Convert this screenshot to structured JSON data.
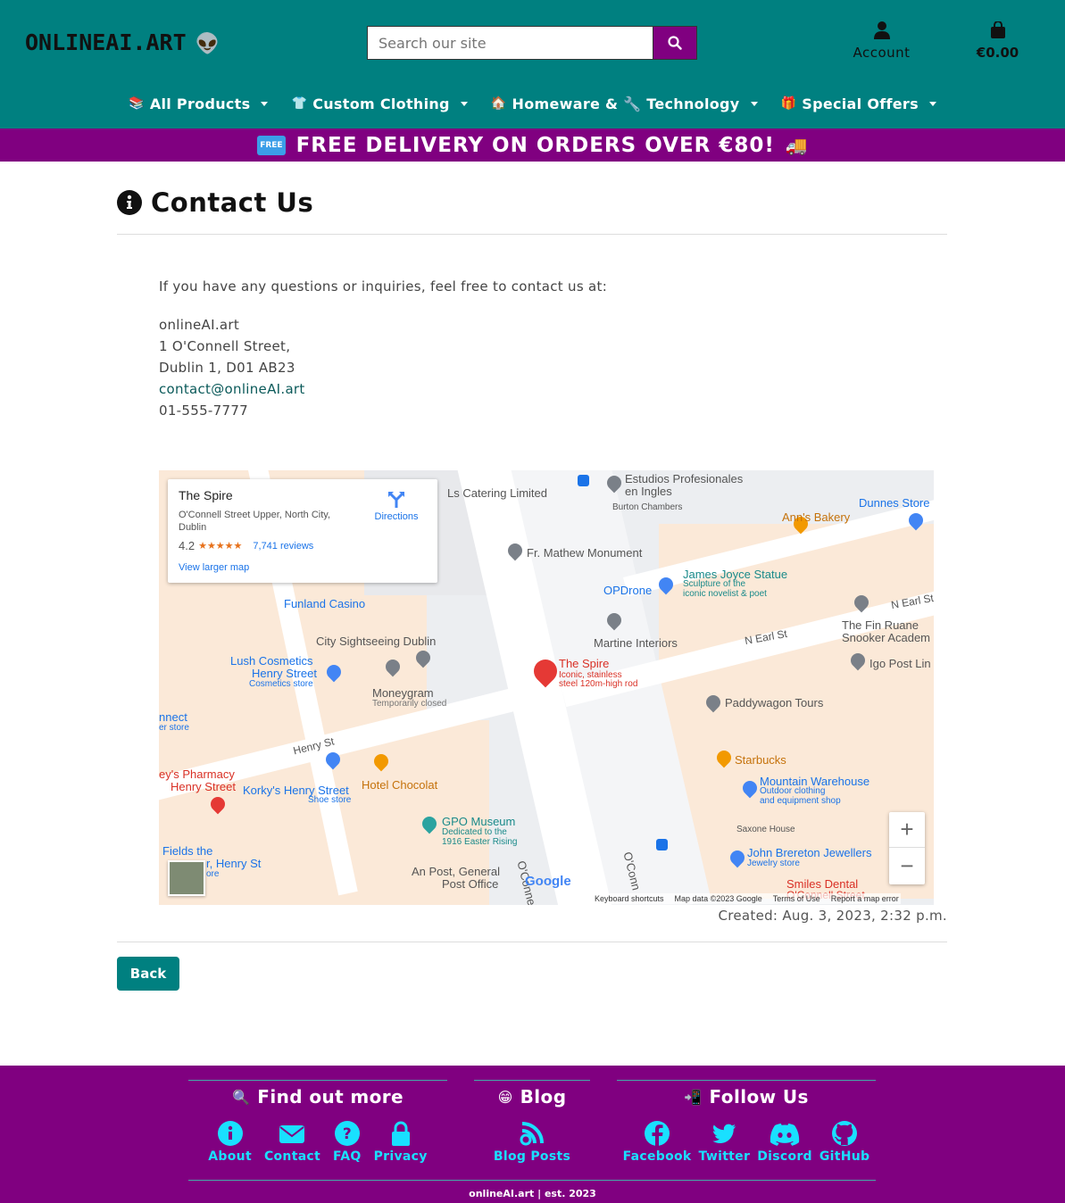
{
  "header": {
    "logo": "ONLINEAI.ART",
    "search_placeholder": "Search our site",
    "account_label": "Account",
    "cart_total": "€0.00"
  },
  "nav": [
    {
      "emoji": "📚",
      "label": "All Products"
    },
    {
      "emoji": "👕",
      "label": "Custom Clothing"
    },
    {
      "emoji": "🏠",
      "label": "Homeware & 🔧 Technology"
    },
    {
      "emoji": "🎁",
      "label": "Special Offers"
    }
  ],
  "promo": {
    "badge": "FREE",
    "text": "FREE DELIVERY ON ORDERS OVER €80!",
    "truck": "🚚"
  },
  "main": {
    "title": "Contact Us",
    "intro": "If you have any questions or inquiries, feel free to contact us at:",
    "address_lines": [
      "onlineAI.art",
      "1 O'Connell Street,",
      "Dublin 1, D01 AB23"
    ],
    "email": "contact@onlineAI.art",
    "phone": "01-555-7777",
    "created": "Created: Aug. 3, 2023, 2:32 p.m.",
    "back_label": "Back"
  },
  "map": {
    "place_title": "The Spire",
    "place_address": "O'Connell Street Upper, North City, Dublin",
    "rating": "4.2",
    "stars": "★★★★★",
    "reviews": "7,741 reviews",
    "larger_map": "View larger map",
    "directions": "Directions",
    "labels": {
      "ls_catering": "Ls Catering Limited",
      "estudios": "Estudios Profesionales",
      "estudios2": "en Ingles",
      "burton": "Burton Chambers",
      "dunnes": "Dunnes Store",
      "anns": "Ann's Bakery",
      "mathew": "Fr. Mathew Monument",
      "joyce": "James Joyce Statue",
      "joyce_sub1": "Sculpture of the",
      "joyce_sub2": "iconic novelist & poet",
      "opdrone": "OPDrone",
      "funland": "Funland Casino",
      "earl_st": "N Earl St",
      "earl_st2": "N Earl St",
      "fin_ruane": "The Fin Ruane",
      "fin_ruane2": "Snooker Academ",
      "city_sight": "City Sightseeing Dublin",
      "martine": "Martine Interiors",
      "lush": "Lush Cosmetics",
      "lush2": "Henry Street",
      "lush_sub": "Cosmetics store",
      "spire": "The Spire",
      "spire_sub1": "Iconic, stainless",
      "spire_sub2": "steel 120m-high rod",
      "igo": "Igo Post Lin",
      "moneygram": "Moneygram",
      "moneygram_sub": "Temporarily closed",
      "paddywagon": "Paddywagon Tours",
      "connect": "nnect",
      "connect_sub": "er store",
      "henry_st": "Henry St",
      "starbucks": "Starbucks",
      "pharmacy": "ey's Pharmacy",
      "pharmacy2": "Henry Street",
      "korkys": "Korky's Henry Street",
      "korkys_sub": "Shoe store",
      "chocolat": "Hotel Chocolat",
      "mountain": "Mountain Warehouse",
      "mountain_sub1": "Outdoor clothing",
      "mountain_sub2": "and equipment shop",
      "gpo": "GPO Museum",
      "gpo_sub1": "Dedicated to the",
      "gpo_sub2": "1916 Easter Rising",
      "saxone": "Saxone House",
      "fields": "Fields the",
      "fields2": "r, Henry St",
      "fields_sub": "ore",
      "brereton": "John Brereton Jewellers",
      "brereton_sub": "Jewelry store",
      "oconnell": "O'Connell Stree",
      "oconnell2": "O'Conn",
      "anpost": "An Post, General",
      "anpost2": "Post Office",
      "smiles": "Smiles Dental",
      "smiles2": "O'Connell Street",
      "google": "Google"
    },
    "footer": {
      "shortcuts": "Keyboard shortcuts",
      "mapdata": "Map data ©2023 Google",
      "terms": "Terms of Use",
      "report": "Report a map error"
    },
    "zoom_in": "+",
    "zoom_out": "−"
  },
  "footer": {
    "find_out_more": {
      "emoji": "🔍",
      "title": "Find out more",
      "links": [
        "About",
        "Contact",
        "FAQ",
        "Privacy"
      ]
    },
    "blog": {
      "emoji": "😁",
      "title": "Blog",
      "links": [
        "Blog Posts"
      ]
    },
    "follow": {
      "emoji": "📲",
      "title": "Follow Us",
      "links": [
        "Facebook",
        "Twitter",
        "Discord",
        "GitHub"
      ]
    },
    "copyright": "onlineAI.art | est. 2023"
  },
  "colors": {
    "teal": "#008080",
    "purple": "#800080",
    "cyan_link": "#19e0ff"
  }
}
